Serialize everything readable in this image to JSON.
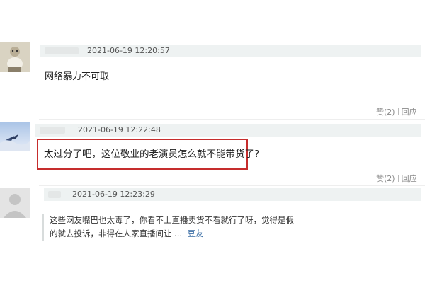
{
  "comments": [
    {
      "timestamp": "2021-06-19 12:20:57",
      "text": "网络暴力不可取",
      "like_label": "赞",
      "like_count": "(2)",
      "reply_label": "回应"
    },
    {
      "timestamp": "2021-06-19 12:22:48",
      "text": "太过分了吧，这位敬业的老演员怎么就不能带货了?",
      "like_label": "赞",
      "like_count": "(2)",
      "reply_label": "回应"
    },
    {
      "timestamp": "2021-06-19 12:23:29",
      "quote_line1": "这些网友嘴巴也太毒了，你看不上直播卖货不看就行了呀，觉得是假",
      "quote_line2": "的就去投诉，非得在人家直播间让 ...",
      "quote_source": "豆友"
    }
  ],
  "colors": {
    "highlight": "#c62d2d",
    "meta_bg": "#eef2f2",
    "link": "#3b6ea5"
  }
}
